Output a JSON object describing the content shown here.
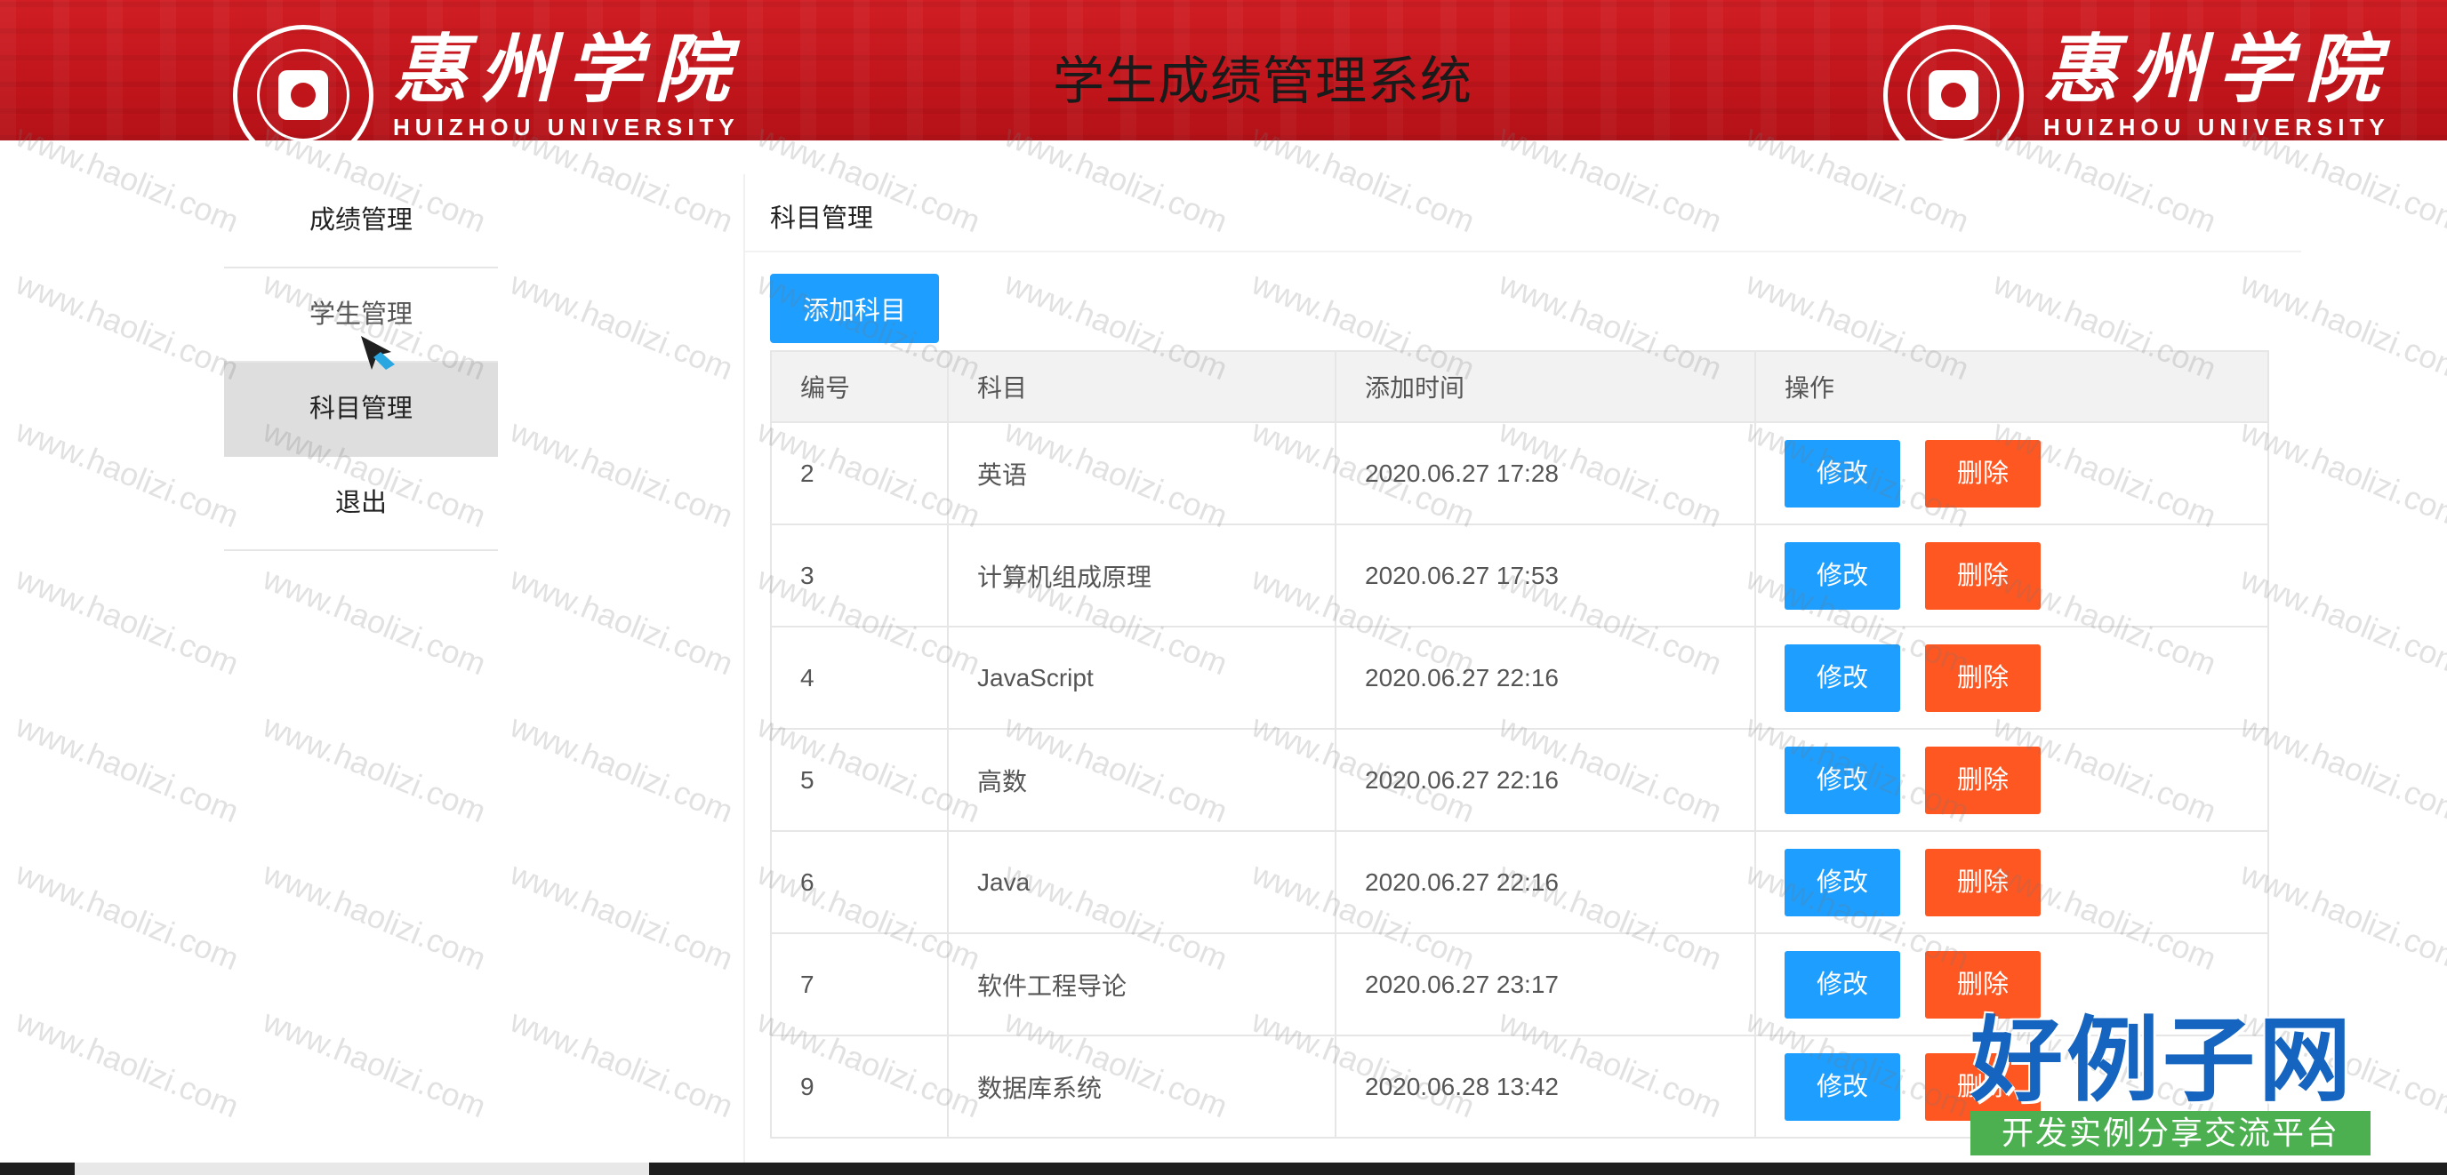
{
  "header": {
    "title": "学生成绩管理系统",
    "logo_name": "惠州学院",
    "logo_english": "HUIZHOU UNIVERSITY"
  },
  "sidebar": {
    "items": [
      {
        "label": "成绩管理",
        "active": false
      },
      {
        "label": "学生管理",
        "active": false
      },
      {
        "label": "科目管理",
        "active": true
      },
      {
        "label": "退出",
        "active": false
      }
    ]
  },
  "main": {
    "title": "科目管理",
    "add_button": "添加科目",
    "columns": [
      "编号",
      "科目",
      "添加时间",
      "操作"
    ],
    "rows": [
      {
        "id": "2",
        "subject": "英语",
        "time": "2020.06.27 17:28"
      },
      {
        "id": "3",
        "subject": "计算机组成原理",
        "time": "2020.06.27 17:53"
      },
      {
        "id": "4",
        "subject": "JavaScript",
        "time": "2020.06.27 22:16"
      },
      {
        "id": "5",
        "subject": "高数",
        "time": "2020.06.27 22:16"
      },
      {
        "id": "6",
        "subject": "Java",
        "time": "2020.06.27 22:16"
      },
      {
        "id": "7",
        "subject": "软件工程导论",
        "time": "2020.06.27 23:17"
      },
      {
        "id": "9",
        "subject": "数据库系统",
        "time": "2020.06.28 13:42"
      }
    ],
    "edit_label": "修改",
    "delete_label": "删除"
  },
  "watermark": {
    "text": "www.haolizi.com",
    "brand_main": "好例子网",
    "brand_sub": "开发实例分享交流平台"
  },
  "colors": {
    "header_red": "#c0151b",
    "primary_blue": "#1e9fff",
    "danger_orange": "#ff5722",
    "active_nav_bg": "#dedede"
  }
}
